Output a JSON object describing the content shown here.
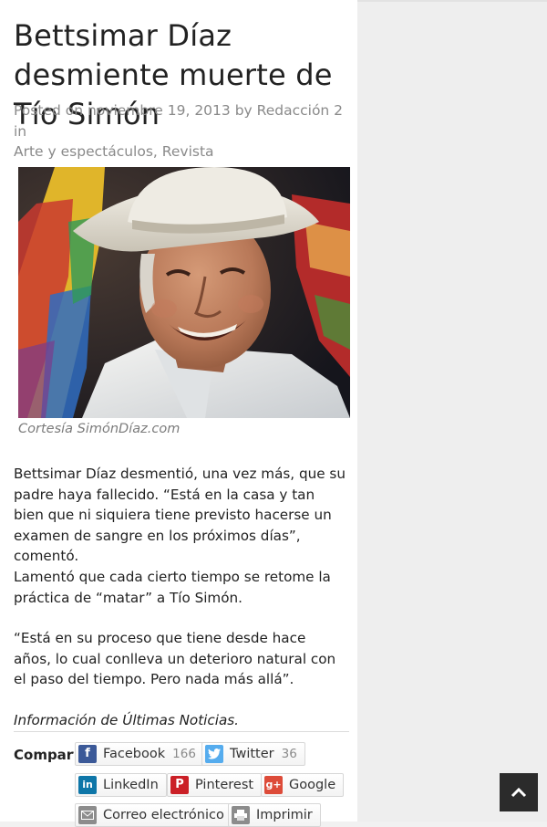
{
  "article": {
    "title": "Bettsimar Díaz desmiente muerte de Tío Simón",
    "meta": {
      "posted_on": "Posted on",
      "date": "noviembre 19, 2013",
      "by": "by",
      "author": "Redacción 2",
      "in": "in",
      "category_1": "Arte y espectáculos",
      "separator": ",",
      "category_2": "Revista"
    },
    "image_caption": "Cortesía SimónDíaz.com",
    "paragraphs": [
      "Bettsimar Díaz desmentió, una vez más, que su padre haya fallecido. “Está en la casa y tan bien que ni siquiera tiene previsto hacerse un examen de sangre en los próximos días”, comentó.",
      "Lamentó que cada cierto tiempo se retome la práctica de “matar” a Tío Simón.",
      "“Está en su proceso que tiene desde hace años, lo cual conlleva un deterioro natural con el paso del tiempo. Pero nada más allá”."
    ],
    "source": "Información de Últimas Noticias."
  },
  "share": {
    "label": "Compartir",
    "facebook": {
      "label": "Facebook",
      "count": "166",
      "icon": "facebook-icon",
      "color": "#3b5998"
    },
    "twitter": {
      "label": "Twitter",
      "count": "36",
      "icon": "twitter-icon",
      "color": "#55acee"
    },
    "linkedin": {
      "label": "LinkedIn",
      "icon": "linkedin-icon",
      "color": "#0e76a8"
    },
    "pinterest": {
      "label": "Pinterest",
      "icon": "pinterest-icon",
      "color": "#cb2027"
    },
    "google": {
      "label": "Google",
      "icon": "google-plus-icon",
      "color": "#dd4b39"
    },
    "email": {
      "label": "Correo electrónico",
      "icon": "mail-icon",
      "color": "#8c8c8c"
    },
    "print": {
      "label": "Imprimir",
      "icon": "print-icon",
      "color": "#8c8c8c"
    }
  },
  "scroll_top": {
    "icon": "chevron-up-icon"
  }
}
